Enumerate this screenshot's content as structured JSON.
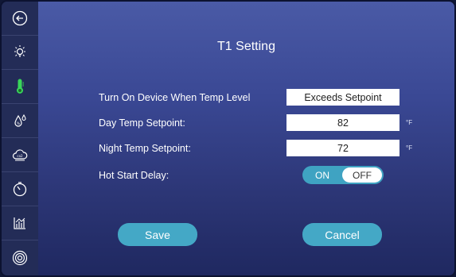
{
  "sidebar": {
    "items": [
      {
        "icon": "back-arrow-icon"
      },
      {
        "icon": "light-bulb-icon"
      },
      {
        "icon": "thermometer-icon",
        "active": true
      },
      {
        "icon": "humidity-drop-icon"
      },
      {
        "icon": "co2-cloud-icon"
      },
      {
        "icon": "timer-icon"
      },
      {
        "icon": "chart-icon"
      },
      {
        "icon": "settings-rings-icon"
      }
    ],
    "active_color": "#39d65a",
    "icon_color": "#ffffff"
  },
  "main": {
    "title": "T1 Setting",
    "rows": {
      "turn_on_label": "Turn On Device When Temp Level",
      "turn_on_value": "Exceeds Setpoint",
      "day_label": "Day Temp Setpoint:",
      "day_value": "82",
      "day_unit": "°F",
      "night_label": "Night Temp Setpoint:",
      "night_value": "72",
      "night_unit": "°F",
      "hot_start_label": "Hot Start Delay:"
    },
    "toggle": {
      "on_label": "ON",
      "off_label": "OFF",
      "selected": "OFF"
    },
    "buttons": {
      "save_label": "Save",
      "cancel_label": "Cancel"
    }
  },
  "colors": {
    "accent": "#44a8c6",
    "sidebar_bg": "#232c57"
  }
}
